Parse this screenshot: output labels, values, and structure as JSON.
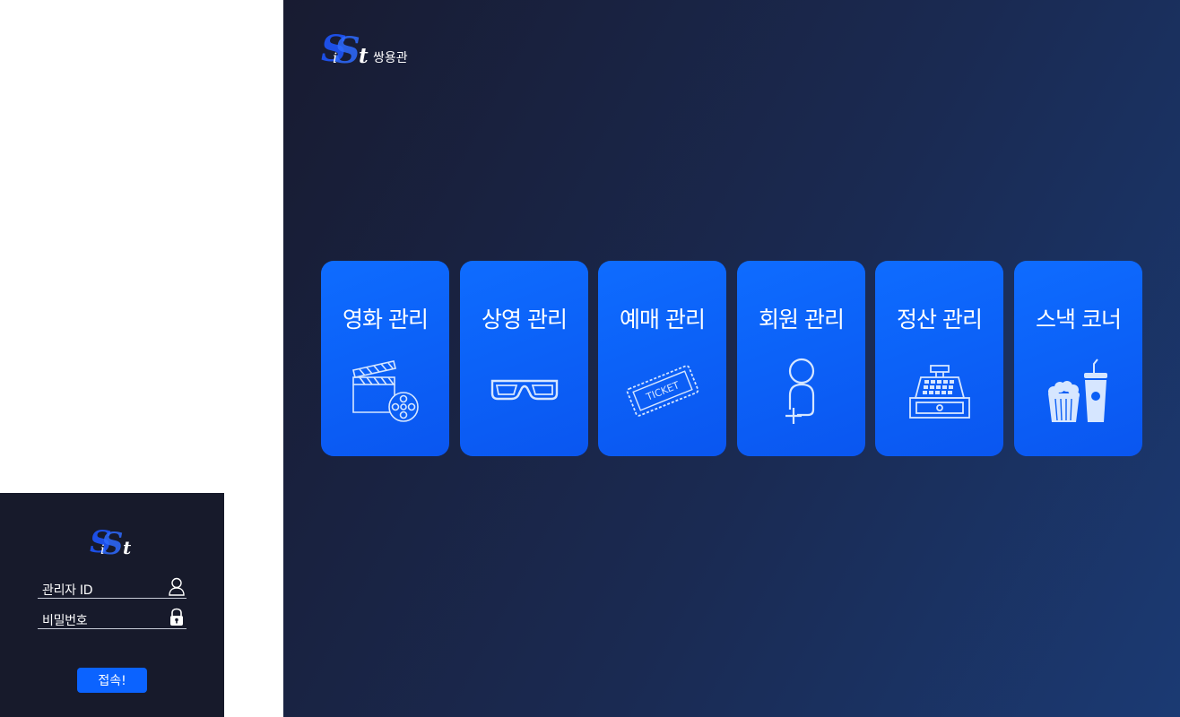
{
  "login": {
    "admin_id_label": "관리자 ID",
    "password_label": "비밀번호",
    "submit_label": "접속!",
    "logo_letters": "SiSt"
  },
  "header": {
    "logo_letters": "SiSt",
    "brand_name": "쌍용관"
  },
  "menu": {
    "items": [
      {
        "label": "영화 관리",
        "icon": "film-clapper-reel-icon"
      },
      {
        "label": "상영 관리",
        "icon": "3d-glasses-icon"
      },
      {
        "label": "예매 관리",
        "icon": "ticket-icon"
      },
      {
        "label": "회원 관리",
        "icon": "add-member-icon"
      },
      {
        "label": "정산 관리",
        "icon": "cash-register-icon"
      },
      {
        "label": "스낵 코너",
        "icon": "popcorn-drink-icon"
      }
    ],
    "ticket_text": "TICKET"
  },
  "colors": {
    "card_blue": "#0b63ff",
    "panel_dark": "#171a2b",
    "icon_stroke": "#d6e6ff"
  }
}
